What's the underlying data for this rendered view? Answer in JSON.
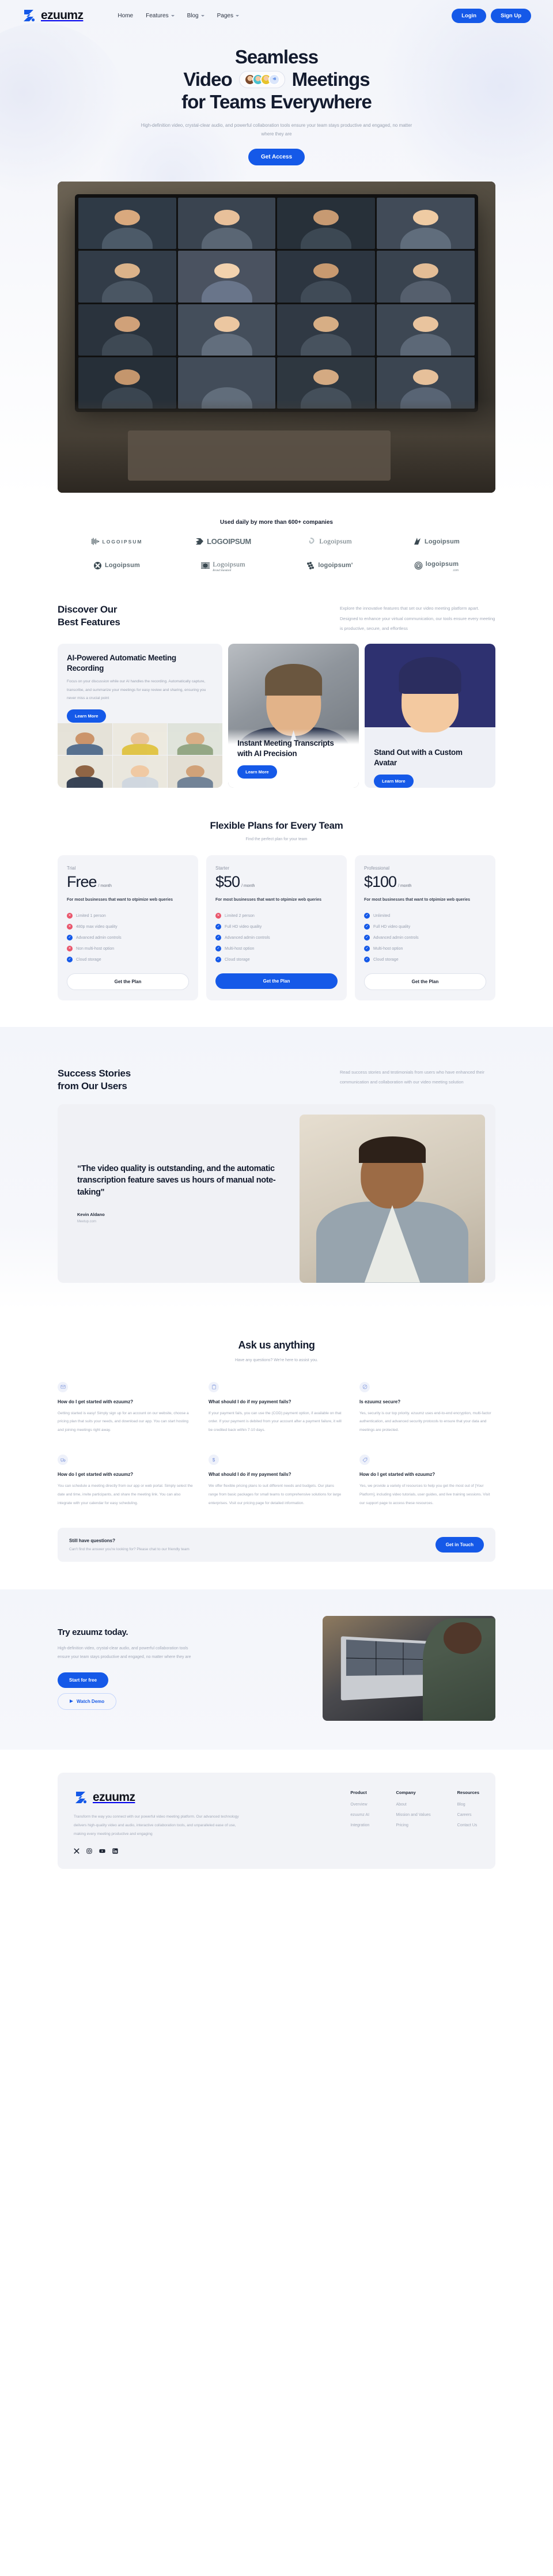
{
  "brand": {
    "name": "ezuumz",
    "logo_color": "#1559e8"
  },
  "nav": {
    "items": [
      {
        "label": "Home",
        "caret": false
      },
      {
        "label": "Features",
        "caret": true
      },
      {
        "label": "Blog",
        "caret": true
      },
      {
        "label": "Pages",
        "caret": true
      }
    ],
    "login_label": "Login",
    "signup_label": "Sign Up"
  },
  "hero": {
    "line1": "Seamless",
    "line2_a": "Video",
    "line2_b": "Meetings",
    "line3": "for Teams Everywhere",
    "avatar_more": "+9",
    "subtitle": "High-definition video, crystal-clear audio, and powerful collaboration tools ensure your team stays productive and engaged, no matter where they are",
    "cta_label": "Get Access"
  },
  "logos": {
    "heading": "Used daily by more than 600+ companies",
    "items": [
      {
        "text": "LOGOIPSUM",
        "style": "spaced",
        "mark": "bars"
      },
      {
        "text": "LOGOIPSUM",
        "style": "bold",
        "mark": "fox"
      },
      {
        "text": "Logoipsum",
        "style": "serif",
        "mark": "knot"
      },
      {
        "text": "Logoipsum",
        "style": "bold",
        "mark": "flash"
      },
      {
        "text": "Logoipsum",
        "style": "bold",
        "mark": "circlex"
      },
      {
        "text": "Logoipsum",
        "style": "serif",
        "sub": "Brand Standard",
        "mark": "stripes"
      },
      {
        "text": "logoipsum'",
        "style": "bold",
        "mark": "dots"
      },
      {
        "text": "logoipsum",
        "style": "bold",
        "tld": ".com",
        "mark": "spiral"
      }
    ]
  },
  "features": {
    "title_line1": "Discover Our",
    "title_line2": "Best Features",
    "description": "Explore the innovative features that set our video meeting platform apart. Designed to enhance your virtual communication, our tools ensure every meeting is productive, secure, and effortless",
    "cards": [
      {
        "title": "AI-Powered Automatic Meeting Recording",
        "body": "Focus on your discussion while our AI handles the recording. Automatically capture, transcribe, and summarize your meetings for easy review and sharing, ensuring you never miss a crucial point",
        "button": "Learn More"
      },
      {
        "title": "Instant Meeting Transcripts with AI Precision",
        "body": "",
        "button": "Learn More"
      },
      {
        "title": "Stand Out with a Custom Avatar",
        "body": "",
        "button": "Learn More"
      }
    ]
  },
  "pricing": {
    "title": "Flexible Plans for Every Team",
    "subtitle": "Find the perfect plan for your team",
    "plans": [
      {
        "tier": "Trial",
        "price": "Free",
        "period": "/ month",
        "blurb": "For most businesses that want to otpimize web queries",
        "features": [
          {
            "label": "Limited 1 person",
            "ok": false
          },
          {
            "label": "480p max video quality",
            "ok": false
          },
          {
            "label": "Advanced admin controls",
            "ok": true
          },
          {
            "label": "Non multi-host option",
            "ok": false
          },
          {
            "label": "Cloud storage",
            "ok": true
          }
        ],
        "button": "Get the Plan",
        "highlight": false
      },
      {
        "tier": "Starter",
        "price": "$50",
        "period": "/ month",
        "blurb": "For most businesses that want to otpimize web queries",
        "features": [
          {
            "label": "Limited 2 person",
            "ok": false
          },
          {
            "label": "Full HD video quality",
            "ok": true
          },
          {
            "label": "Advanced admin controls",
            "ok": true
          },
          {
            "label": "Multi-host option",
            "ok": true
          },
          {
            "label": "Cloud storage",
            "ok": true
          }
        ],
        "button": "Get the Plan",
        "highlight": true
      },
      {
        "tier": "Professional",
        "price": "$100",
        "period": "/ month",
        "blurb": "For most businesses that want to otpimize web queries",
        "features": [
          {
            "label": "Unlimited",
            "ok": true
          },
          {
            "label": "Full HD video quality",
            "ok": true
          },
          {
            "label": "Advanced admin controls",
            "ok": true
          },
          {
            "label": "Multi-host option",
            "ok": true
          },
          {
            "label": "Cloud storage",
            "ok": true
          }
        ],
        "button": "Get the Plan",
        "highlight": false
      }
    ]
  },
  "stories": {
    "title_line1": "Success Stories",
    "title_line2": "from Our Users",
    "description": "Read success stories and testimonials from users who have enhanced their communication and collaboration with our video meeting solution",
    "quote": "“The video quality is outstanding, and the automatic transcription feature saves us hours of manual note-taking\"",
    "author": "Kevin Aldano",
    "role": "Meetup.com"
  },
  "faq": {
    "title": "Ask us anything",
    "subtitle": "Have any questions? We're here to assist you.",
    "items": [
      {
        "icon": "envelope-icon",
        "glyph": "✉",
        "question": "How do I get started with ezuumz?",
        "answer": "Getting started is easy! Simply sign up for an account on our website, choose a pricing plan that suits your needs, and download our app. You can start hosting and joining meetings right away."
      },
      {
        "icon": "clipboard-icon",
        "glyph": "ὌB",
        "question": "What should I do if my payment fails?",
        "answer": "If your payment fails, you can use the (COD) payment option, if available on that order. If your payment is debited from your account after a payment failure, it will be credited back within 7-10 days."
      },
      {
        "icon": "no-entry-icon",
        "glyph": "⊘",
        "question": "Is ezuumz secure?",
        "answer": "Yes, security is our top priority. ezuumz uses end-to-end encryption, multi-factor authentication, and advanced security protocols to ensure that your data and meetings are protected."
      },
      {
        "icon": "truck-icon",
        "glyph": "ὩA",
        "question": "How do I get started with ezuumz?",
        "answer": "You can schedule a meeting directly from our app or web portal. Simply select the date and time, invite participants, and share the meeting link. You can also integrate with your calendar for easy scheduling."
      },
      {
        "icon": "dollar-icon",
        "glyph": "$",
        "question": "What should I do if my payment fails?",
        "answer": "We offer flexible pricing plans to suit different needs and budgets. Our plans range from basic packages for small teams to comprehensive solutions for large enterprises. Visit our pricing page for detailed information."
      },
      {
        "icon": "tag-icon",
        "glyph": "Ἷ7",
        "question": "How do I get started with ezuumz?",
        "answer": "Yes, we provide a variety of resources to help you get the most out of [Your Platform], including video tutorials, user guides, and live training sessions. Visit our support page to access these resources."
      }
    ],
    "still": {
      "title": "Still have questions?",
      "text": "Can't find the answer you're looking for? Please chat to our friendly team",
      "button": "Get in Touch"
    }
  },
  "cta": {
    "title": "Try ezuumz today.",
    "text": "High-definition video, crystal-clear audio, and powerful collaboration tools ensure your team stays productive and engaged, no matter where they are",
    "primary_button": "Start for free",
    "secondary_button": "Watch Demo"
  },
  "footer": {
    "description": "Transform the way you connect with our powerful video meeting platform. Our advanced technology delivers high-quality video and audio, interactive collaboration tools, and unparalleled ease of use, making every meeting productive and engaging",
    "socials": [
      {
        "name": "x-icon",
        "glyph": "✕"
      },
      {
        "name": "instagram-icon",
        "glyph": "▢"
      },
      {
        "name": "youtube-icon",
        "glyph": "▶"
      },
      {
        "name": "linkedin-icon",
        "glyph": "in"
      }
    ],
    "columns": [
      {
        "heading": "Product",
        "links": [
          "Overview",
          "ezuumz AI",
          "Integration"
        ]
      },
      {
        "heading": "Company",
        "links": [
          "About",
          "Mission and Values",
          "Pricing"
        ]
      },
      {
        "heading": "Resources",
        "links": [
          "Blog",
          "Careers",
          "Contact Us"
        ]
      }
    ]
  }
}
